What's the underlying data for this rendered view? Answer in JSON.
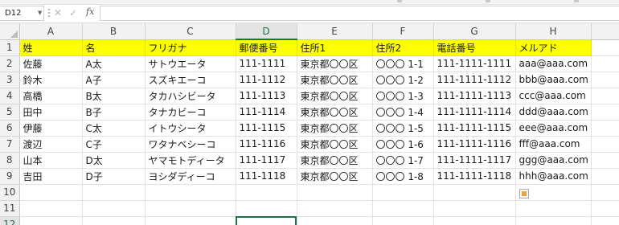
{
  "name_box": {
    "value": "D12"
  },
  "formula_bar": {
    "cancel_icon": "✕",
    "enter_icon": "✓",
    "fx_label": "fx",
    "value": ""
  },
  "columns": [
    "A",
    "B",
    "C",
    "D",
    "E",
    "F",
    "G",
    "H"
  ],
  "active_column": "D",
  "rows": [
    {
      "num": "1",
      "cells": [
        "姓",
        "名",
        "フリガナ",
        "郵便番号",
        "住所1",
        "住所2",
        "電話番号",
        "メルアド"
      ]
    },
    {
      "num": "2",
      "cells": [
        "佐藤",
        "A太",
        "サトウエータ",
        "111-1111",
        "東京都〇〇区",
        "〇〇〇 1-1",
        "111-1111-1111",
        "aaa@aaa.com"
      ]
    },
    {
      "num": "3",
      "cells": [
        "鈴木",
        "A子",
        "スズキエーコ",
        "111-1112",
        "東京都〇〇区",
        "〇〇〇 1-2",
        "111-1111-1112",
        "bbb@aaa.com"
      ]
    },
    {
      "num": "4",
      "cells": [
        "高橋",
        "B太",
        "タカハシビータ",
        "111-1113",
        "東京都〇〇区",
        "〇〇〇 1-3",
        "111-1111-1113",
        "ccc@aaa.com"
      ]
    },
    {
      "num": "5",
      "cells": [
        "田中",
        "B子",
        "タナカビーコ",
        "111-1114",
        "東京都〇〇区",
        "〇〇〇 1-4",
        "111-1111-1114",
        "ddd@aaa.com"
      ]
    },
    {
      "num": "6",
      "cells": [
        "伊藤",
        "C太",
        "イトウシータ",
        "111-1115",
        "東京都〇〇区",
        "〇〇〇 1-5",
        "111-1111-1115",
        "eee@aaa.com"
      ]
    },
    {
      "num": "7",
      "cells": [
        "渡辺",
        "C子",
        "ワタナベシーコ",
        "111-1116",
        "東京都〇〇区",
        "〇〇〇 1-6",
        "111-1111-1116",
        "fff@aaa.com"
      ]
    },
    {
      "num": "8",
      "cells": [
        "山本",
        "D太",
        "ヤマモトディータ",
        "111-1117",
        "東京都〇〇区",
        "〇〇〇 1-7",
        "111-1111-1117",
        "ggg@aaa.com"
      ]
    },
    {
      "num": "9",
      "cells": [
        "吉田",
        "D子",
        "ヨシダディーコ",
        "111-1118",
        "東京都〇〇区",
        "〇〇〇 1-8",
        "111-1111-1118",
        "hhh@aaa.com"
      ]
    },
    {
      "num": "10",
      "cells": [
        "",
        "",
        "",
        "",
        "",
        "",
        "",
        ""
      ]
    },
    {
      "num": "11",
      "cells": [
        "",
        "",
        "",
        "",
        "",
        "",
        "",
        ""
      ]
    },
    {
      "num": "12",
      "cells": [
        "",
        "",
        "",
        "",
        "",
        "",
        "",
        ""
      ]
    }
  ],
  "active_row": "12",
  "selected_cell": "D12",
  "colors": {
    "header_fill": "#ffff00",
    "selection": "#1e7145",
    "gridline": "#e1e1e1"
  },
  "icons": {
    "quick_analysis": "quick-analysis-icon"
  }
}
